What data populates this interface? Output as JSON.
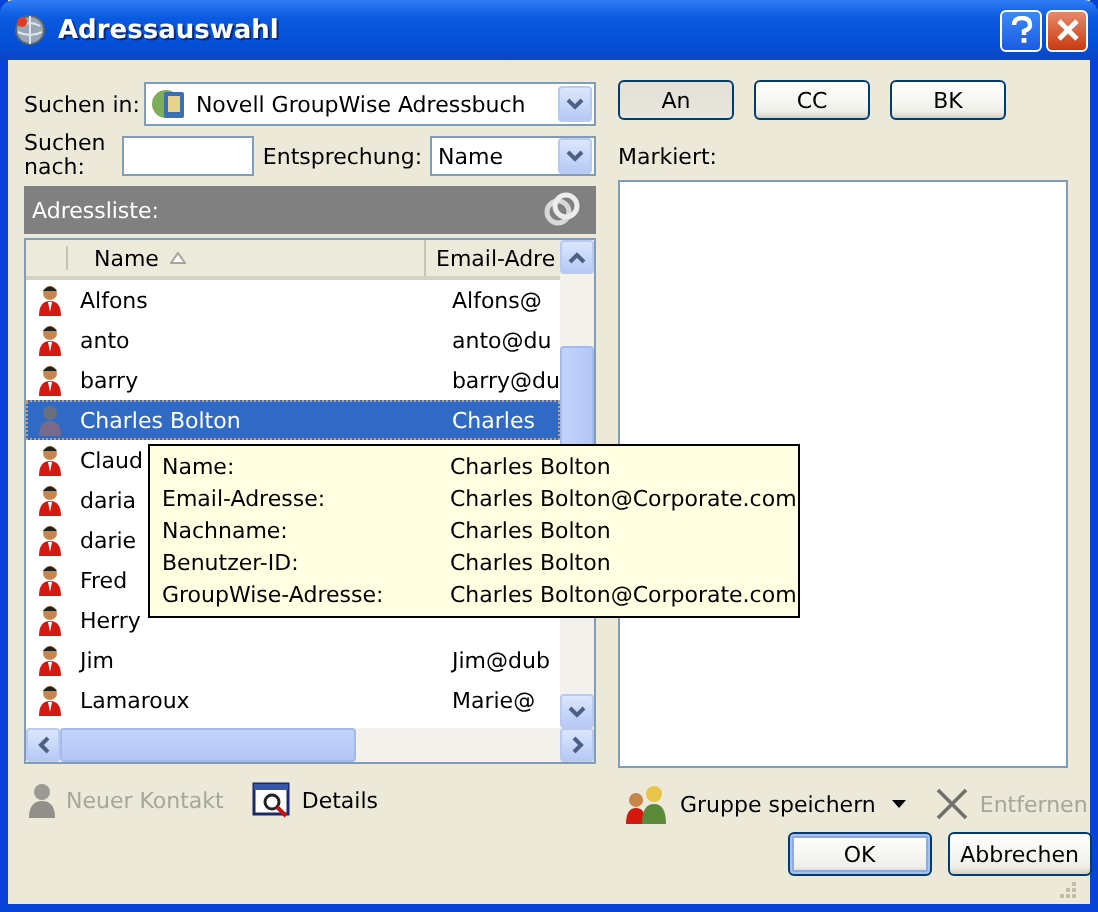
{
  "window": {
    "title": "Adressauswahl"
  },
  "search_in": {
    "label": "Suchen in:",
    "value": "Novell GroupWise Adressbuch"
  },
  "search_for": {
    "label": "Suchen\nnach:"
  },
  "match": {
    "label": "Entsprechung:",
    "value": "Name"
  },
  "address_list": {
    "title": "Adressliste:",
    "columns": [
      {
        "label": "Name",
        "sorted": true
      },
      {
        "label": "Email-Adre"
      }
    ],
    "rows": [
      {
        "name": "Alfons",
        "email": "Alfons@",
        "selected": false
      },
      {
        "name": "anto",
        "email": "anto@du",
        "selected": false
      },
      {
        "name": "barry",
        "email": "barry@du",
        "selected": false
      },
      {
        "name": "Charles Bolton",
        "email": "Charles",
        "selected": true
      },
      {
        "name": "Claud",
        "selected": false
      },
      {
        "name": "daria",
        "selected": false
      },
      {
        "name": "darie",
        "selected": false
      },
      {
        "name": "Fred",
        "selected": false
      },
      {
        "name": "Herry",
        "selected": false
      },
      {
        "name": "Jim",
        "email": "Jim@dub",
        "selected": false
      },
      {
        "name": "Lamaroux",
        "email": "Marie@",
        "selected": false
      }
    ]
  },
  "tooltip": {
    "rows": [
      {
        "label": "Name:",
        "value": "Charles Bolton"
      },
      {
        "label": "Email-Adresse:",
        "value": "Charles Bolton@Corporate.com"
      },
      {
        "label": "Nachname:",
        "value": "Charles Bolton"
      },
      {
        "label": "Benutzer-ID:",
        "value": "Charles Bolton"
      },
      {
        "label": "GroupWise-Adresse:",
        "value": "Charles Bolton@Corporate.com"
      }
    ]
  },
  "recipient_buttons": [
    {
      "label": "An",
      "pressed": true
    },
    {
      "label": "CC",
      "pressed": false
    },
    {
      "label": "BK",
      "pressed": false
    }
  ],
  "marked": {
    "label": "Markiert:"
  },
  "left_actions": [
    {
      "kind": "new-contact",
      "label": "Neuer Kontakt",
      "disabled": true
    },
    {
      "kind": "details",
      "label": "Details",
      "disabled": false
    }
  ],
  "right_actions": [
    {
      "kind": "save-group",
      "label": "Gruppe speichern",
      "disabled": false,
      "dropdown": true
    },
    {
      "kind": "remove",
      "label": "Entfernen",
      "disabled": true,
      "dropdown": false
    }
  ],
  "buttons": [
    {
      "label": "OK",
      "default": true
    },
    {
      "label": "Abbrechen",
      "default": false
    }
  ]
}
